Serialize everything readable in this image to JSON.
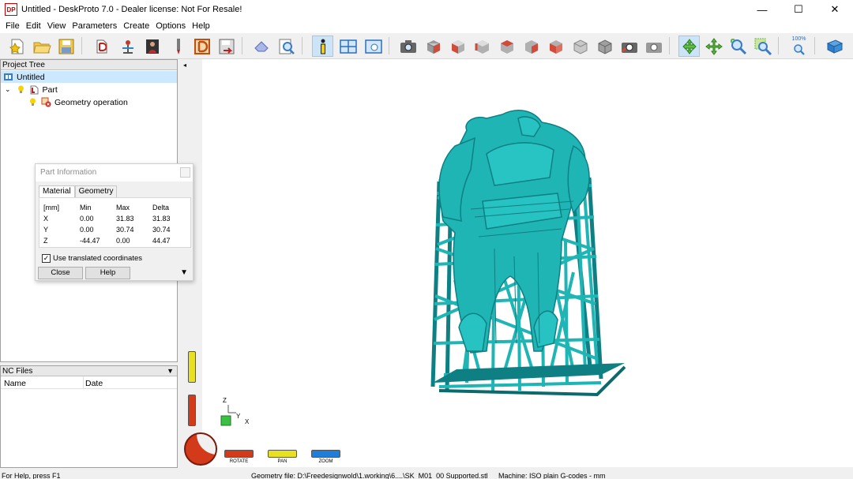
{
  "window": {
    "title": "Untitled - DeskProto 7.0 - Dealer license: Not For Resale!",
    "logo_text": "DP",
    "controls": {
      "minimize": "—",
      "maximize": "☐",
      "close": "✕"
    }
  },
  "menu": [
    "File",
    "Edit",
    "View",
    "Parameters",
    "Create",
    "Options",
    "Help"
  ],
  "toolbar": {
    "zoom_percent_label": "100%"
  },
  "project_tree": {
    "header": "Project Tree",
    "items": [
      {
        "label": "Untitled",
        "level": 0
      },
      {
        "label": "Part",
        "level": 1
      },
      {
        "label": "Geometry operation",
        "level": 2
      }
    ]
  },
  "nc_files": {
    "header": "NC Files",
    "columns": [
      "Name",
      "Date"
    ]
  },
  "part_info": {
    "title": "Part Information",
    "tabs": [
      "Material",
      "Geometry"
    ],
    "columns": [
      "[mm]",
      "Min",
      "Max",
      "Delta"
    ],
    "rows": [
      [
        "X",
        "0.00",
        "31.83",
        "31.83"
      ],
      [
        "Y",
        "0.00",
        "30.74",
        "30.74"
      ],
      [
        "Z",
        "-44.47",
        "0.00",
        "44.47"
      ]
    ],
    "checkbox_label": "Use translated coordinates",
    "checkbox_checked": true,
    "buttons": {
      "close": "Close",
      "help": "Help"
    }
  },
  "view_controls": {
    "rotate": "ROTATE",
    "pan": "PAN",
    "zoom": "ZOOM"
  },
  "axes": {
    "z": "Z",
    "y": "Y",
    "x": "X"
  },
  "status": {
    "help": "For Help, press F1",
    "geometry_file": "Geometry file: D:\\Freedesignwold\\1.working\\6....\\SK_M01_00 Supported.stl",
    "machine": "Machine: ISO plain G-codes - mm"
  },
  "colors": {
    "model": "#1fb5b5",
    "model_dark": "#0e7f82",
    "selection": "#cce8ff",
    "rotate": "#d23a1a",
    "pan": "#e8e020",
    "zoom": "#1f7fd8"
  }
}
